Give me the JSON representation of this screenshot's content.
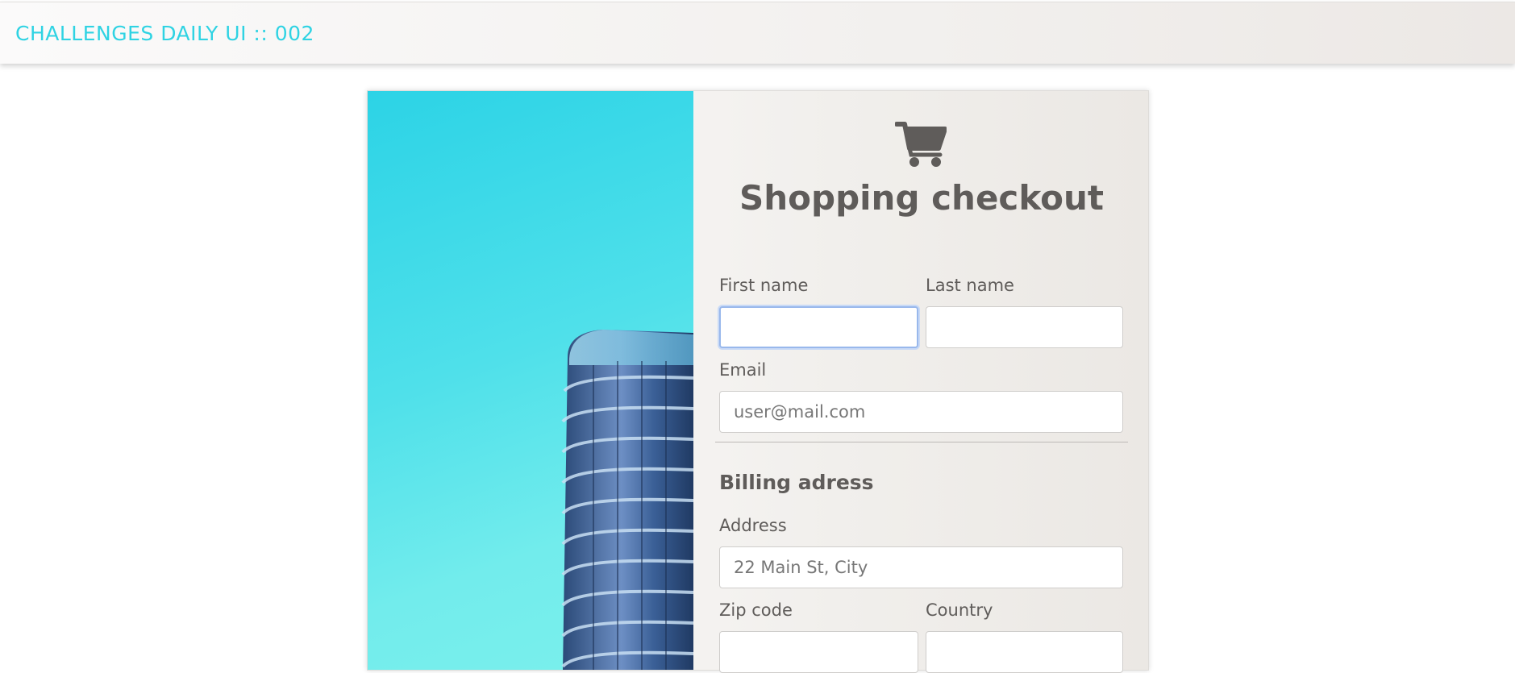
{
  "header": {
    "brand": "CHALLENGES DAILY UI :: 002"
  },
  "form": {
    "title": "Shopping checkout",
    "first_name_label": "First name",
    "last_name_label": "Last name",
    "email_label": "Email",
    "email_placeholder": "user@mail.com",
    "billing_title": "Billing adress",
    "address_label": "Address",
    "address_placeholder": "22 Main St, City",
    "zip_label": "Zip code",
    "country_label": "Country"
  },
  "colors": {
    "brand": "#2fd3e3",
    "text": "#5f5c5a",
    "focus": "#99b8ec"
  },
  "icons": {
    "cart": "cart-icon"
  }
}
